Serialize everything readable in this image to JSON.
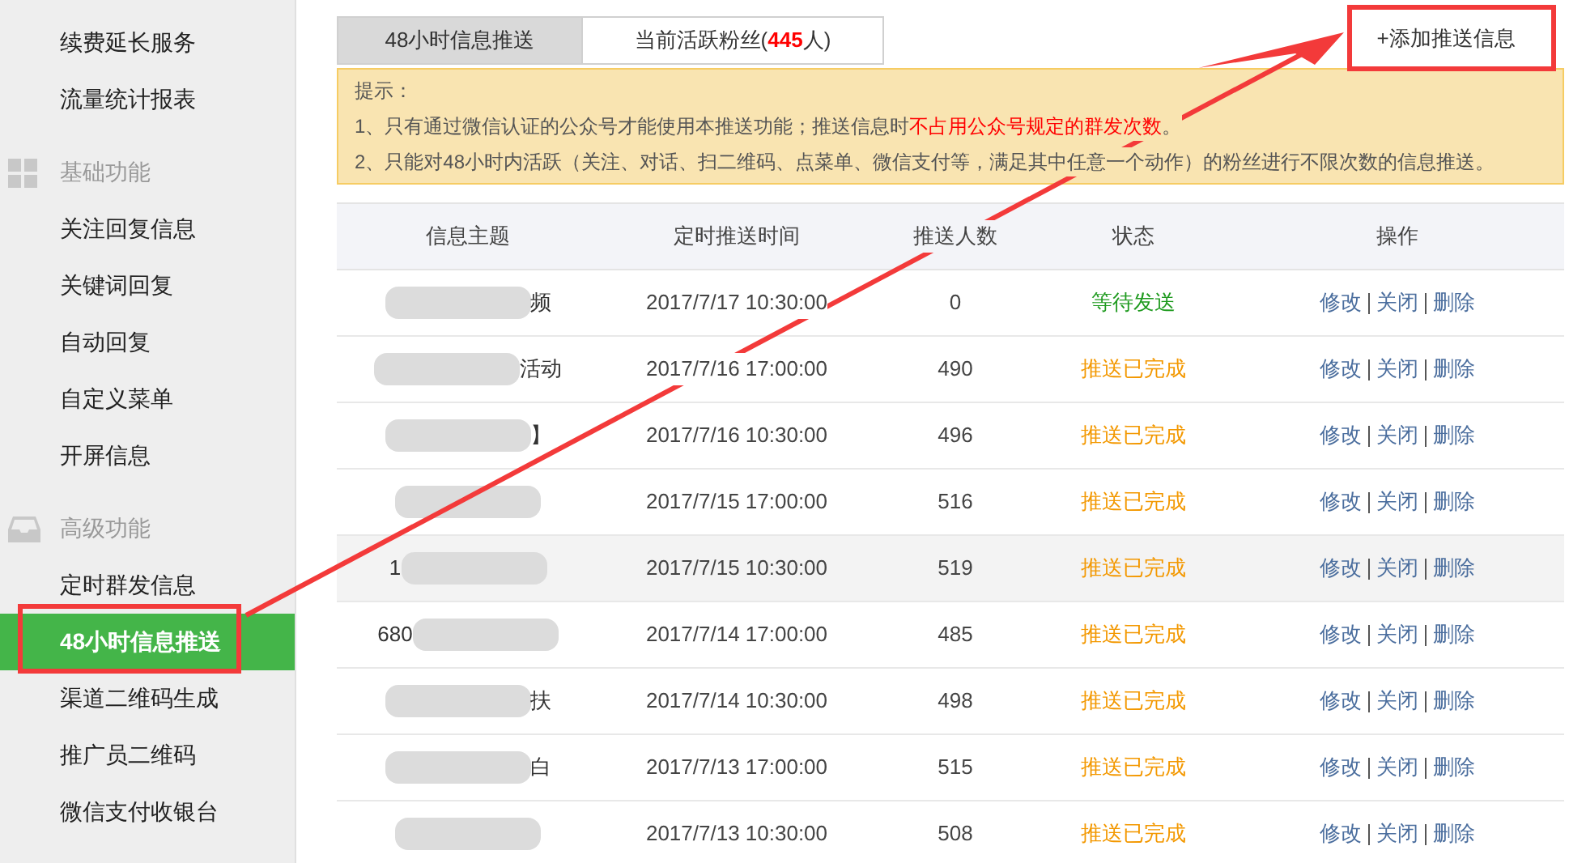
{
  "sidebar": {
    "items": [
      {
        "kind": "item",
        "label": "续费延长服务",
        "selected": false
      },
      {
        "kind": "item",
        "label": "流量统计报表",
        "selected": false
      },
      {
        "kind": "section",
        "label": "基础功能"
      },
      {
        "kind": "item",
        "label": "关注回复信息",
        "selected": false
      },
      {
        "kind": "item",
        "label": "关键词回复",
        "selected": false
      },
      {
        "kind": "item",
        "label": "自动回复",
        "selected": false
      },
      {
        "kind": "item",
        "label": "自定义菜单",
        "selected": false
      },
      {
        "kind": "item",
        "label": "开屏信息",
        "selected": false
      },
      {
        "kind": "section",
        "label": "高级功能"
      },
      {
        "kind": "item",
        "label": "定时群发信息",
        "selected": false
      },
      {
        "kind": "item",
        "label": "48小时信息推送",
        "selected": true
      },
      {
        "kind": "item",
        "label": "渠道二维码生成",
        "selected": false
      },
      {
        "kind": "item",
        "label": "推广员二维码",
        "selected": false
      },
      {
        "kind": "item",
        "label": "微信支付收银台",
        "selected": false
      }
    ]
  },
  "tabs": [
    {
      "label": "48小时信息推送",
      "selected": true
    },
    {
      "label": "当前活跃粉丝(**445**人)",
      "selected": false
    }
  ],
  "add_button": "+添加推送信息",
  "notice": {
    "title": "提示：",
    "lines": [
      {
        "before": "1、只有通过微信认证的公众号才能使用本推送功能；推送信息时",
        "highlight": "不占用公众号规定的群发次数",
        "after": "。"
      },
      {
        "before": "2、只能对48小时内活跃（关注、对话、扫二维码、点菜单、微信支付等，满足其中任意一个动作）的粉丝进行不限次数的信息推送。"
      }
    ]
  },
  "table": {
    "columns": [
      "信息主题",
      "定时推送时间",
      "推送人数",
      "状态",
      "操作"
    ],
    "rows": [
      {
        "subject_before": "",
        "subject_after": "频",
        "time": "2017/7/17 10:30:00",
        "count": "0",
        "status": "等待发送",
        "completed": false,
        "highlighted": false,
        "actions": [
          "修改",
          "关闭",
          "删除"
        ]
      },
      {
        "subject_before": "",
        "subject_after": "活动",
        "time": "2017/7/16 17:00:00",
        "count": "490",
        "status": "推送已完成",
        "completed": true,
        "highlighted": false,
        "actions": [
          "修改",
          "关闭",
          "删除"
        ]
      },
      {
        "subject_before": "",
        "subject_after": "】",
        "time": "2017/7/16 10:30:00",
        "count": "496",
        "status": "推送已完成",
        "completed": true,
        "highlighted": false,
        "actions": [
          "修改",
          "关闭",
          "删除"
        ]
      },
      {
        "subject_before": "",
        "subject_after": "",
        "time": "2017/7/15 17:00:00",
        "count": "516",
        "status": "推送已完成",
        "completed": true,
        "highlighted": false,
        "actions": [
          "修改",
          "关闭",
          "删除"
        ]
      },
      {
        "subject_before": "1",
        "subject_after": "",
        "time": "2017/7/15 10:30:00",
        "count": "519",
        "status": "推送已完成",
        "completed": true,
        "highlighted": true,
        "actions": [
          "修改",
          "关闭",
          "删除"
        ]
      },
      {
        "subject_before": "680",
        "subject_after": "",
        "time": "2017/7/14 17:00:00",
        "count": "485",
        "status": "推送已完成",
        "completed": true,
        "highlighted": false,
        "actions": [
          "修改",
          "关闭",
          "删除"
        ]
      },
      {
        "subject_before": "",
        "subject_after": "扶",
        "time": "2017/7/14 10:30:00",
        "count": "498",
        "status": "推送已完成",
        "completed": true,
        "highlighted": false,
        "actions": [
          "修改",
          "关闭",
          "删除"
        ]
      },
      {
        "subject_before": "",
        "subject_after": "白",
        "time": "2017/7/13 17:00:00",
        "count": "515",
        "status": "推送已完成",
        "completed": true,
        "highlighted": false,
        "actions": [
          "修改",
          "关闭",
          "删除"
        ]
      },
      {
        "subject_before": "",
        "subject_after": "",
        "time": "2017/7/13 10:30:00",
        "count": "508",
        "status": "推送已完成",
        "completed": true,
        "highlighted": false,
        "actions": [
          "修改",
          "关闭",
          "删除"
        ]
      }
    ]
  }
}
